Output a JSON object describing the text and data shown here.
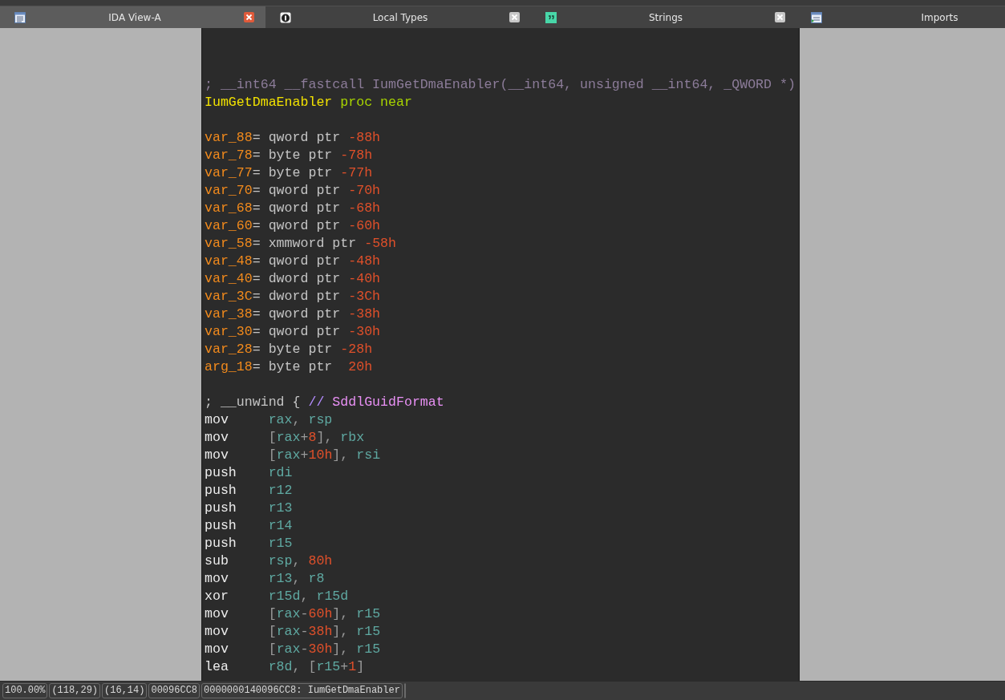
{
  "tabs": [
    {
      "label": "IDA View-A",
      "selected": true,
      "closable": true
    },
    {
      "label": "Local Types",
      "selected": false,
      "closable": true
    },
    {
      "label": "Strings",
      "selected": false,
      "closable": true
    },
    {
      "label": "Imports",
      "selected": false,
      "closable": false
    }
  ],
  "listing": [
    {
      "kind": "code",
      "tokens": [
        {
          "kind": "comment",
          "text": "; __int64 __fastcall IumGetDmaEnabler(__int64, unsigned __int64, _QWORD *)"
        }
      ]
    },
    {
      "kind": "code",
      "tokens": [
        {
          "kind": "label",
          "text": "IumGetDmaEnabler"
        },
        {
          "kind": "directive",
          "text": " proc near"
        }
      ]
    },
    {
      "kind": "blank"
    },
    {
      "kind": "code",
      "tokens": [
        {
          "kind": "var",
          "text": "var_88"
        },
        {
          "kind": "plain",
          "text": "= qword ptr "
        },
        {
          "kind": "num",
          "text": "-88h"
        }
      ]
    },
    {
      "kind": "code",
      "tokens": [
        {
          "kind": "var",
          "text": "var_78"
        },
        {
          "kind": "plain",
          "text": "= byte ptr "
        },
        {
          "kind": "num",
          "text": "-78h"
        }
      ]
    },
    {
      "kind": "code",
      "tokens": [
        {
          "kind": "var",
          "text": "var_77"
        },
        {
          "kind": "plain",
          "text": "= byte ptr "
        },
        {
          "kind": "num",
          "text": "-77h"
        }
      ]
    },
    {
      "kind": "code",
      "tokens": [
        {
          "kind": "var",
          "text": "var_70"
        },
        {
          "kind": "plain",
          "text": "= qword ptr "
        },
        {
          "kind": "num",
          "text": "-70h"
        }
      ]
    },
    {
      "kind": "code",
      "tokens": [
        {
          "kind": "var",
          "text": "var_68"
        },
        {
          "kind": "plain",
          "text": "= qword ptr "
        },
        {
          "kind": "num",
          "text": "-68h"
        }
      ]
    },
    {
      "kind": "code",
      "tokens": [
        {
          "kind": "var",
          "text": "var_60"
        },
        {
          "kind": "plain",
          "text": "= qword ptr "
        },
        {
          "kind": "num",
          "text": "-60h"
        }
      ]
    },
    {
      "kind": "code",
      "tokens": [
        {
          "kind": "var",
          "text": "var_58"
        },
        {
          "kind": "plain",
          "text": "= xmmword ptr "
        },
        {
          "kind": "num",
          "text": "-58h"
        }
      ]
    },
    {
      "kind": "code",
      "tokens": [
        {
          "kind": "var",
          "text": "var_48"
        },
        {
          "kind": "plain",
          "text": "= qword ptr "
        },
        {
          "kind": "num",
          "text": "-48h"
        }
      ]
    },
    {
      "kind": "code",
      "tokens": [
        {
          "kind": "var",
          "text": "var_40"
        },
        {
          "kind": "plain",
          "text": "= dword ptr "
        },
        {
          "kind": "num",
          "text": "-40h"
        }
      ]
    },
    {
      "kind": "code",
      "tokens": [
        {
          "kind": "var",
          "text": "var_3C"
        },
        {
          "kind": "plain",
          "text": "= dword ptr "
        },
        {
          "kind": "num",
          "text": "-3Ch"
        }
      ]
    },
    {
      "kind": "code",
      "tokens": [
        {
          "kind": "var",
          "text": "var_38"
        },
        {
          "kind": "plain",
          "text": "= qword ptr "
        },
        {
          "kind": "num",
          "text": "-38h"
        }
      ]
    },
    {
      "kind": "code",
      "tokens": [
        {
          "kind": "var",
          "text": "var_30"
        },
        {
          "kind": "plain",
          "text": "= qword ptr "
        },
        {
          "kind": "num",
          "text": "-30h"
        }
      ]
    },
    {
      "kind": "code",
      "tokens": [
        {
          "kind": "var",
          "text": "var_28"
        },
        {
          "kind": "plain",
          "text": "= byte ptr "
        },
        {
          "kind": "num",
          "text": "-28h"
        }
      ]
    },
    {
      "kind": "code",
      "tokens": [
        {
          "kind": "var",
          "text": "arg_18"
        },
        {
          "kind": "plain",
          "text": "= byte ptr  "
        },
        {
          "kind": "num",
          "text": "20h"
        }
      ]
    },
    {
      "kind": "blank"
    },
    {
      "kind": "code",
      "tokens": [
        {
          "kind": "plain",
          "text": "; __unwind { "
        },
        {
          "kind": "slash",
          "text": "// "
        },
        {
          "kind": "handler",
          "text": "SddlGuidFormat"
        }
      ]
    },
    {
      "kind": "code",
      "tokens": [
        {
          "kind": "mnem",
          "text": "mov"
        },
        {
          "kind": "reg",
          "text": "rax"
        },
        {
          "kind": "punct",
          "text": ", "
        },
        {
          "kind": "reg",
          "text": "rsp"
        }
      ]
    },
    {
      "kind": "code",
      "tokens": [
        {
          "kind": "mnem",
          "text": "mov"
        },
        {
          "kind": "punct",
          "text": "["
        },
        {
          "kind": "reg",
          "text": "rax"
        },
        {
          "kind": "punct",
          "text": "+"
        },
        {
          "kind": "num",
          "text": "8"
        },
        {
          "kind": "punct",
          "text": "], "
        },
        {
          "kind": "reg",
          "text": "rbx"
        }
      ]
    },
    {
      "kind": "code",
      "tokens": [
        {
          "kind": "mnem",
          "text": "mov"
        },
        {
          "kind": "punct",
          "text": "["
        },
        {
          "kind": "reg",
          "text": "rax"
        },
        {
          "kind": "punct",
          "text": "+"
        },
        {
          "kind": "num",
          "text": "10h"
        },
        {
          "kind": "punct",
          "text": "], "
        },
        {
          "kind": "reg",
          "text": "rsi"
        }
      ]
    },
    {
      "kind": "code",
      "tokens": [
        {
          "kind": "mnem",
          "text": "push"
        },
        {
          "kind": "reg",
          "text": "rdi"
        }
      ]
    },
    {
      "kind": "code",
      "tokens": [
        {
          "kind": "mnem",
          "text": "push"
        },
        {
          "kind": "reg",
          "text": "r12"
        }
      ]
    },
    {
      "kind": "code",
      "tokens": [
        {
          "kind": "mnem",
          "text": "push"
        },
        {
          "kind": "reg",
          "text": "r13"
        }
      ]
    },
    {
      "kind": "code",
      "tokens": [
        {
          "kind": "mnem",
          "text": "push"
        },
        {
          "kind": "reg",
          "text": "r14"
        }
      ]
    },
    {
      "kind": "code",
      "tokens": [
        {
          "kind": "mnem",
          "text": "push"
        },
        {
          "kind": "reg",
          "text": "r15"
        }
      ]
    },
    {
      "kind": "code",
      "tokens": [
        {
          "kind": "mnem",
          "text": "sub"
        },
        {
          "kind": "reg",
          "text": "rsp"
        },
        {
          "kind": "punct",
          "text": ", "
        },
        {
          "kind": "num",
          "text": "80h"
        }
      ]
    },
    {
      "kind": "code",
      "tokens": [
        {
          "kind": "mnem",
          "text": "mov"
        },
        {
          "kind": "reg",
          "text": "r13"
        },
        {
          "kind": "punct",
          "text": ", "
        },
        {
          "kind": "reg",
          "text": "r8"
        }
      ]
    },
    {
      "kind": "code",
      "tokens": [
        {
          "kind": "mnem",
          "text": "xor"
        },
        {
          "kind": "reg",
          "text": "r15d"
        },
        {
          "kind": "punct",
          "text": ", "
        },
        {
          "kind": "reg",
          "text": "r15d"
        }
      ]
    },
    {
      "kind": "code",
      "tokens": [
        {
          "kind": "mnem",
          "text": "mov"
        },
        {
          "kind": "punct",
          "text": "["
        },
        {
          "kind": "reg",
          "text": "rax"
        },
        {
          "kind": "punct",
          "text": "-"
        },
        {
          "kind": "num",
          "text": "60h"
        },
        {
          "kind": "punct",
          "text": "], "
        },
        {
          "kind": "reg",
          "text": "r15"
        }
      ]
    },
    {
      "kind": "code",
      "tokens": [
        {
          "kind": "mnem",
          "text": "mov"
        },
        {
          "kind": "punct",
          "text": "["
        },
        {
          "kind": "reg",
          "text": "rax"
        },
        {
          "kind": "punct",
          "text": "-"
        },
        {
          "kind": "num",
          "text": "38h"
        },
        {
          "kind": "punct",
          "text": "], "
        },
        {
          "kind": "reg",
          "text": "r15"
        }
      ]
    },
    {
      "kind": "code",
      "tokens": [
        {
          "kind": "mnem",
          "text": "mov"
        },
        {
          "kind": "punct",
          "text": "["
        },
        {
          "kind": "reg",
          "text": "rax"
        },
        {
          "kind": "punct",
          "text": "-"
        },
        {
          "kind": "num",
          "text": "30h"
        },
        {
          "kind": "punct",
          "text": "], "
        },
        {
          "kind": "reg",
          "text": "r15"
        }
      ]
    },
    {
      "kind": "code",
      "tokens": [
        {
          "kind": "mnem",
          "text": "lea"
        },
        {
          "kind": "reg",
          "text": "r8d"
        },
        {
          "kind": "punct",
          "text": ", ["
        },
        {
          "kind": "reg",
          "text": "r15"
        },
        {
          "kind": "punct",
          "text": "+"
        },
        {
          "kind": "num",
          "text": "1"
        },
        {
          "kind": "punct",
          "text": "]"
        }
      ]
    }
  ],
  "status_bar": [
    "100.00%",
    "(118,29)",
    "(16,14)",
    "00096CC8",
    "0000000140096CC8: IumGetDmaEnabler"
  ]
}
